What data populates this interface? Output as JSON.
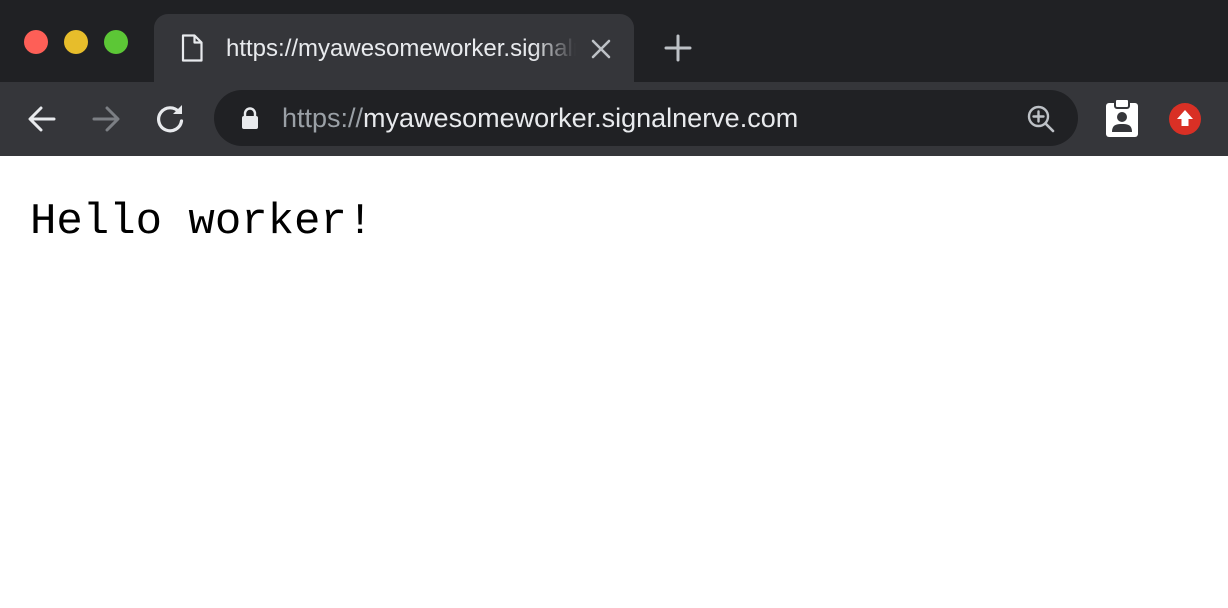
{
  "tab": {
    "title": "https://myawesomeworker.signalnerve.com"
  },
  "omnibox": {
    "scheme": "https://",
    "host": "myawesomeworker.signalnerve.com"
  },
  "page": {
    "text": "Hello worker!"
  },
  "colors": {
    "titlebar": "#202124",
    "toolbar": "#35363a",
    "omnibox": "#202124",
    "traffic_close": "#fe5f57",
    "traffic_minimize": "#e7bd2b",
    "traffic_maximize": "#5cc736",
    "update_badge": "#d93025"
  },
  "icons": {
    "tab": "document-icon",
    "tab_close": "close-icon",
    "new_tab": "plus-icon",
    "back": "arrow-left-icon",
    "forward": "arrow-right-icon",
    "reload": "reload-icon",
    "lock": "lock-icon",
    "zoom": "zoom-in-icon",
    "extension": "clipboard-user-icon",
    "update": "update-arrow-icon"
  }
}
